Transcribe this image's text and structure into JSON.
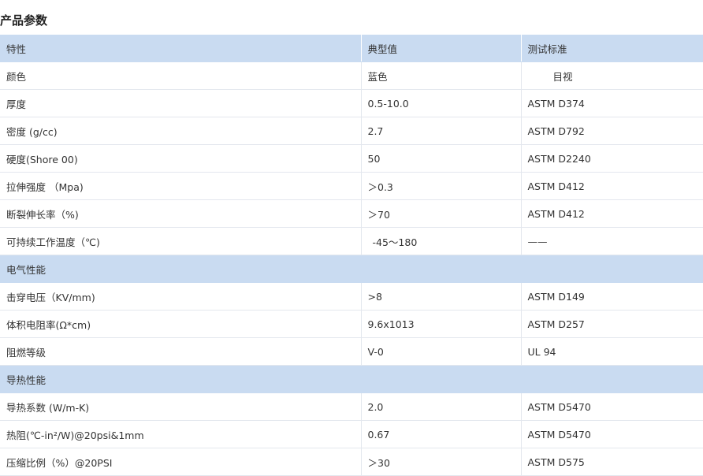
{
  "title": "产品参数",
  "columns": [
    "特性",
    "典型值",
    "测试标准"
  ],
  "rows": [
    [
      "颜色",
      "蓝色",
      "目视"
    ],
    [
      "厚度",
      "0.5-10.0",
      "ASTM D374"
    ],
    [
      "密度 (g/cc)",
      "2.7",
      "ASTM D792"
    ],
    [
      "硬度(Shore 00)",
      "50",
      "ASTM D2240"
    ],
    [
      "拉伸强度 （Mpa)",
      "＞0.3",
      "ASTM D412"
    ],
    [
      "断裂伸长率（%)",
      "＞70",
      "ASTM D412"
    ],
    [
      "可持续工作温度（℃)",
      "-45～180",
      "——"
    ]
  ],
  "section_electrical": "电气性能",
  "rows_electrical": [
    [
      "击穿电压（KV/mm)",
      ">8",
      "ASTM D149"
    ],
    [
      "体积电阻率(Ω*cm)",
      "9.6x1013",
      "ASTM D257"
    ],
    [
      "阻燃等级",
      "V-0",
      "UL 94"
    ]
  ],
  "section_thermal": "导热性能",
  "rows_thermal": [
    [
      "导热系数 (W/m-K)",
      "2.0",
      "ASTM D5470"
    ],
    [
      "热阻(℃-in²/W)@20psi&1mm",
      "0.67",
      "ASTM D5470"
    ],
    [
      "压缩比例（%）@20PSI",
      "＞30",
      "ASTM D575"
    ]
  ]
}
